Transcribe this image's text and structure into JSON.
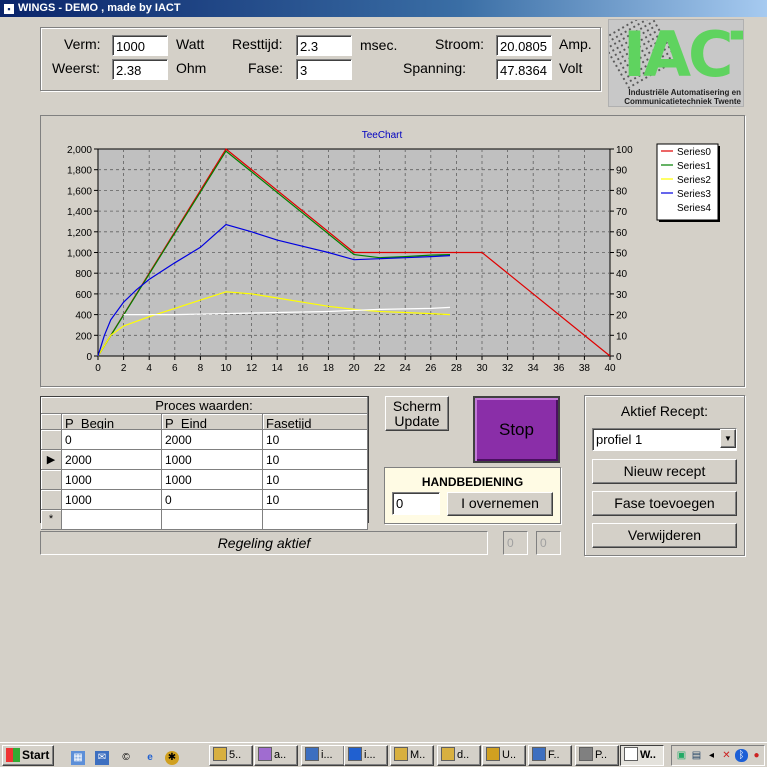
{
  "window": {
    "title": "WINGS - DEMO , made by IACT"
  },
  "readouts": {
    "verm_label": "Verm:",
    "verm_value": "1000",
    "verm_unit": "Watt",
    "weerst_label": "Weerst:",
    "weerst_value": "2.38",
    "weerst_unit": "Ohm",
    "resttijd_label": "Resttijd:",
    "resttijd_value": "2.3",
    "resttijd_unit": "msec.",
    "fase_label": "Fase:",
    "fase_value": "3",
    "stroom_label": "Stroom:",
    "stroom_value": "20.0805",
    "stroom_unit": "Amp.",
    "spanning_label": "Spanning:",
    "spanning_value": "47.8364",
    "spanning_unit": "Volt"
  },
  "logo": {
    "text": "IACT",
    "sub1": "Industriële Automatisering en",
    "sub2": "Communicatietechniek Twente"
  },
  "chart_data": {
    "type": "line",
    "title": "TeeChart",
    "xlim": [
      0,
      40
    ],
    "ylim": [
      0,
      2000
    ],
    "y2lim": [
      0,
      100
    ],
    "x_ticks": [
      "0",
      "2",
      "4",
      "6",
      "8",
      "10",
      "12",
      "14",
      "16",
      "18",
      "20",
      "22",
      "24",
      "26",
      "28",
      "30",
      "32",
      "34",
      "36",
      "38",
      "40"
    ],
    "y_ticks": [
      "0",
      "200",
      "400",
      "600",
      "800",
      "1,000",
      "1,200",
      "1,400",
      "1,600",
      "1,800",
      "2,000"
    ],
    "y2_ticks": [
      "0",
      "10",
      "20",
      "30",
      "40",
      "50",
      "60",
      "70",
      "80",
      "90",
      "100"
    ],
    "grid": true,
    "legend_position": "right",
    "series": [
      {
        "name": "Series0",
        "color": "#e00000",
        "axis": "left",
        "x": [
          0,
          10,
          20,
          30,
          40
        ],
        "y": [
          0,
          2000,
          1000,
          1000,
          0
        ]
      },
      {
        "name": "Series1",
        "color": "#008000",
        "axis": "left",
        "x": [
          0,
          10,
          20,
          22,
          24,
          26,
          27.5
        ],
        "y": [
          0,
          1980,
          980,
          950,
          960,
          975,
          980
        ]
      },
      {
        "name": "Series2",
        "color": "#ffff00",
        "axis": "left",
        "x": [
          0,
          1,
          2,
          4,
          6,
          8,
          10,
          12,
          14,
          16,
          18,
          20,
          22,
          24,
          26,
          27.5
        ],
        "y": [
          0,
          200,
          290,
          380,
          460,
          540,
          620,
          600,
          560,
          520,
          480,
          450,
          430,
          420,
          410,
          400
        ]
      },
      {
        "name": "Series3",
        "color": "#0000e0",
        "axis": "left",
        "x": [
          0,
          0.5,
          1,
          2,
          3,
          4,
          6,
          8,
          10,
          12,
          14,
          16,
          18,
          20,
          22,
          24,
          26,
          27.5
        ],
        "y": [
          0,
          200,
          350,
          520,
          640,
          740,
          900,
          1050,
          1270,
          1200,
          1120,
          1060,
          1000,
          930,
          940,
          950,
          960,
          970
        ]
      },
      {
        "name": "Series4",
        "color": "#ffffff",
        "axis": "left",
        "x": [
          2,
          6,
          10,
          14,
          18,
          22,
          26,
          27.5
        ],
        "y": [
          400,
          400,
          410,
          420,
          430,
          450,
          460,
          470
        ]
      }
    ]
  },
  "grid": {
    "caption": "Proces waarden:",
    "columns": [
      "P_Begin",
      "P_Eind",
      "Fasetijd"
    ],
    "rows": [
      {
        "indicator": "",
        "cells": [
          "0",
          "2000",
          "10"
        ]
      },
      {
        "indicator": "▶",
        "cells": [
          "2000",
          "1000",
          "10"
        ]
      },
      {
        "indicator": "",
        "cells": [
          "1000",
          "1000",
          "10"
        ]
      },
      {
        "indicator": "",
        "cells": [
          "1000",
          "0",
          "10"
        ]
      },
      {
        "indicator": "*",
        "cells": [
          "",
          "",
          ""
        ]
      }
    ]
  },
  "buttons": {
    "scherm_update_1": "Scherm",
    "scherm_update_2": "Update",
    "stop": "Stop",
    "overnemen": "I overnemen",
    "nieuw_recept": "Nieuw recept",
    "fase_toevoegen": "Fase toevoegen",
    "verwijderen": "Verwijderen"
  },
  "handbediening": {
    "title": "HANDBEDIENING",
    "value": "0"
  },
  "recipe": {
    "title": "Aktief Recept:",
    "selected": "profiel 1"
  },
  "status": {
    "text": "Regeling aktief",
    "mini1": "0",
    "mini2": "0"
  },
  "taskbar": {
    "start": "Start",
    "items": [
      "5..",
      "a..",
      "i...",
      "i...",
      "M..",
      "d..",
      "U..",
      "F..",
      "P..",
      "W.."
    ]
  }
}
